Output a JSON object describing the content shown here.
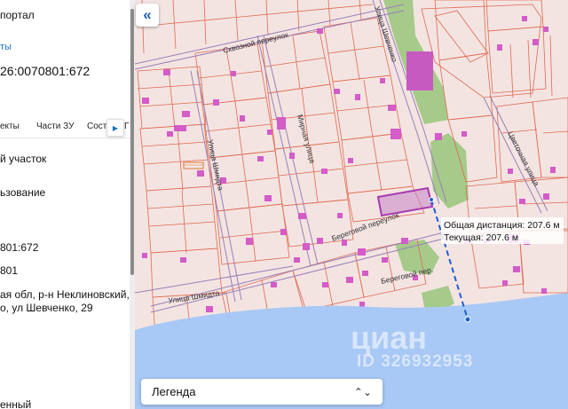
{
  "panel": {
    "portal_title": "портал",
    "link_text": "ты",
    "cadastral_number": "26:0070801:672",
    "tabs": [
      "екты",
      "Части ЗУ",
      "Соста",
      "Г"
    ],
    "object_type": "й участок",
    "usage_label": "ьзование",
    "number_short": "801:672",
    "quarter_short": "801",
    "address_line1": "ая обл, р-н Неклиновский, с",
    "address_line2": "о, ул Шевченко, 29",
    "bottom_text": "енный"
  },
  "map": {
    "streets": [
      "Сквозной переулок",
      "Улица Шевченко",
      "Улица Шмидта",
      "Мирная улица",
      "Береговой переулок",
      "Цветочная улица",
      "Улица Шмидта",
      "Береговой пер."
    ],
    "tooltip": {
      "total_distance": "Общая дистанция: 207.6 м",
      "current": "Текущая: 207.6 м"
    },
    "legend_label": "Легенда",
    "watermark": "циан",
    "watermark_id": "ID 326932953",
    "colors": {
      "background": "#f3e4e2",
      "parcel_line": "#e06a50",
      "building": "#d45bc8",
      "green": "#98c67a",
      "water": "#a8c8f5",
      "measure_line": "#1a5fd4",
      "selected_parcel": "#a83ab0"
    }
  },
  "icons": {
    "collapse": "double-chevron-left-icon",
    "tab_next": "chevron-right-icon",
    "legend_toggle": "chevron-up-down-icon"
  }
}
